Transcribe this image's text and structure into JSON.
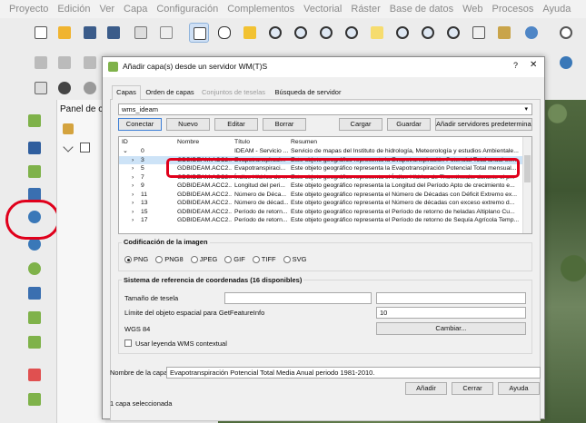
{
  "menubar": [
    "Proyecto",
    "Edición",
    "Ver",
    "Capa",
    "Configuración",
    "Complementos",
    "Vectorial",
    "Ráster",
    "Base de datos",
    "Web",
    "Procesos",
    "Ayuda"
  ],
  "panel": {
    "title": "Panel de ca"
  },
  "dialog": {
    "title": "Añadir capa(s) desde un servidor WM(T)S",
    "help": "?",
    "close": "✕",
    "tabs": [
      "Capas",
      "Orden de capas",
      "Conjuntos de teselas",
      "Búsqueda de servidor"
    ],
    "server": "wms_ideam",
    "buttons": {
      "connect": "Conectar",
      "new": "Nuevo",
      "edit": "Editar",
      "delete": "Borrar",
      "load": "Cargar",
      "save": "Guardar",
      "add_default": "Añadir servidores predeterminados"
    },
    "columns": [
      "ID",
      "Nombre",
      "Título",
      "Resumen"
    ],
    "rows": [
      {
        "id": "0",
        "name": "",
        "title": "IDEAM - Servicio ...",
        "summary": "Servicio de mapas del Instituto de hidrología, Meteorología y estudios Ambientale..."
      },
      {
        "id": "3",
        "name": "GDBIDEAM.ACC2...",
        "title": "Evapotranspiraci...",
        "summary": "Este objeto geográfico representa la Evapotranspiración Potencial Total anual ex..."
      },
      {
        "id": "5",
        "name": "GDBIDEAM.ACC2...",
        "title": "Evapotranspiraci...",
        "summary": "Este objeto geográfico representa la Evapotranspiración Potencial Total mensual..."
      },
      {
        "id": "7",
        "name": "GDBIDEAM.ACC2...",
        "title": "Índice Hídrico de ...",
        "summary": "Este objeto geográfico representa el Índice Hídrico de Thornthwaite durante el p..."
      },
      {
        "id": "9",
        "name": "GDBIDEAM.ACC2...",
        "title": "Longitud del peri...",
        "summary": "Este objeto geográfico representa la Longitud del Período Apto de crecimiento e..."
      },
      {
        "id": "11",
        "name": "GDBIDEAM.ACC2...",
        "title": "Número de Déca...",
        "summary": "Este objeto geográfico representa el Número de Décadas con Déficit Extremo ex..."
      },
      {
        "id": "13",
        "name": "GDBIDEAM.ACC2...",
        "title": "Número de décad...",
        "summary": "Este objeto geográfico representa el Número de décadas con exceso extremo d..."
      },
      {
        "id": "15",
        "name": "GDBIDEAM.ACC2...",
        "title": "Período de retorn...",
        "summary": "Este objeto geográfico representa el Período de retorno de heladas Altiplano Cu..."
      },
      {
        "id": "17",
        "name": "GDBIDEAM.ACC2...",
        "title": "Período de retorn...",
        "summary": "Este objeto geográfico representa el Período de retorno de Sequía Agrícola Temp..."
      }
    ],
    "encoding": {
      "title": "Codificación de la imagen",
      "options": [
        "PNG",
        "PNG8",
        "JPEG",
        "GIF",
        "TIFF",
        "SVG"
      ],
      "selected": "PNG"
    },
    "crs": {
      "title": "Sistema de referencia de coordenadas (16 disponibles)",
      "tile_size": "Tamaño de tesela",
      "feature_limit": "Límite del objeto espacial para GetFeatureInfo",
      "feature_limit_value": "10",
      "crs_name": "WGS 84",
      "change": "Cambiar...",
      "legend": "Usar leyenda WMS contextual"
    },
    "layer_name_label": "Nombre de la capa",
    "layer_name": "Evapotranspiración Potencial Total Media Anual  periodo 1981-2010.",
    "add": "Añadir",
    "close_btn": "Cerrar",
    "help_btn": "Ayuda",
    "status": "1 capa seleccionada"
  }
}
